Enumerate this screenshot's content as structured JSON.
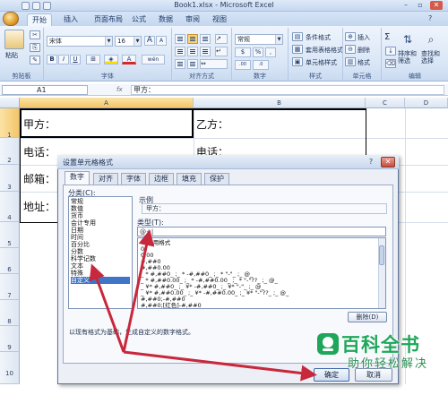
{
  "window": {
    "title": "Book1.xlsx - Microsoft Excel",
    "controls": {
      "minimize": "–",
      "restore": "▫",
      "close": "✕"
    }
  },
  "ribbon": {
    "tabs": [
      "开始",
      "插入",
      "页面布局",
      "公式",
      "数据",
      "审阅",
      "视图"
    ],
    "active_tab": "开始",
    "clipboard": {
      "paste_label": "粘贴",
      "group_label": "剪贴板"
    },
    "font": {
      "name": "宋体",
      "size": "16",
      "bold": "B",
      "italic": "I",
      "underline": "U",
      "group_label": "字体",
      "grow": "A",
      "shrink": "A",
      "font_color_glyph": "A",
      "wen": "wén"
    },
    "alignment": {
      "group_label": "对齐方式"
    },
    "number": {
      "format": "常规",
      "currency": "$",
      "percent": "%",
      "comma": ",",
      "inc_decimal": ".00",
      "dec_decimal": ".0",
      "group_label": "数字"
    },
    "styles": {
      "conditional": "条件格式",
      "as_table": "套用表格格式",
      "cell_styles": "单元格样式",
      "group_label": "样式"
    },
    "cells": {
      "insert": "插入",
      "delete": "删除",
      "format": "格式",
      "group_label": "单元格"
    },
    "editing": {
      "sum": "Σ",
      "sort_filter": "排序和筛选",
      "find_select": "查找和选择",
      "group_label": "编辑"
    }
  },
  "formula_bar": {
    "name_box": "A1",
    "fx": "fx",
    "content": "甲方："
  },
  "sheet": {
    "columns": [
      "A",
      "B",
      "C",
      "D"
    ],
    "rows": [
      "1",
      "2",
      "3",
      "4",
      "5",
      "6",
      "7",
      "8",
      "9",
      "10"
    ],
    "cells_a": [
      "甲方：",
      "电话：",
      "邮箱：",
      "地址："
    ],
    "cells_b": [
      "乙方：",
      "电话："
    ]
  },
  "dialog": {
    "title": "设置单元格格式",
    "help": "?",
    "close": "✕",
    "tabs": [
      "数字",
      "对齐",
      "字体",
      "边框",
      "填充",
      "保护"
    ],
    "active_tab": "数字",
    "category_label": "分类(C):",
    "categories": [
      "常规",
      "数值",
      "货币",
      "会计专用",
      "日期",
      "时间",
      "百分比",
      "分数",
      "科学记数",
      "文本",
      "特殊",
      "自定义"
    ],
    "selected_category": "自定义",
    "sample_label": "示例",
    "sample_value": "甲方：",
    "type_label": "类型(T):",
    "type_value": "@+|",
    "formats": [
      "G/通用格式",
      "0",
      "0.00",
      "#,##0",
      "#,##0.00",
      "_ * #,##0_ ;_ * -#,##0_ ;_ * \"-\"_ ;_ @_",
      "_ * #,##0.00_ ;_ * -#,##0.00_ ;_ * \"-\"??_ ;_ @_",
      "_ ¥* #,##0_ ;_ ¥* -#,##0_ ;_ ¥* \"-\"_ ;_ @_",
      "_ ¥* #,##0.00_ ;_ ¥* -#,##0.00_ ;_ ¥* \"-\"??_ ;_ @_",
      "#,##0;-#,##0",
      "#,##0;[红色]-#,##0"
    ],
    "delete_button": "删除(D)",
    "description": "以现有格式为基础，生成自定义的数字格式。",
    "ok_button": "确定",
    "cancel_button": "取消"
  },
  "watermark": {
    "main": "百科全书",
    "sub": "助你轻松解决"
  },
  "colors": {
    "accent": "#3f74c7",
    "annotation_arrow": "#c8283c",
    "watermark": "#1ea75a"
  }
}
